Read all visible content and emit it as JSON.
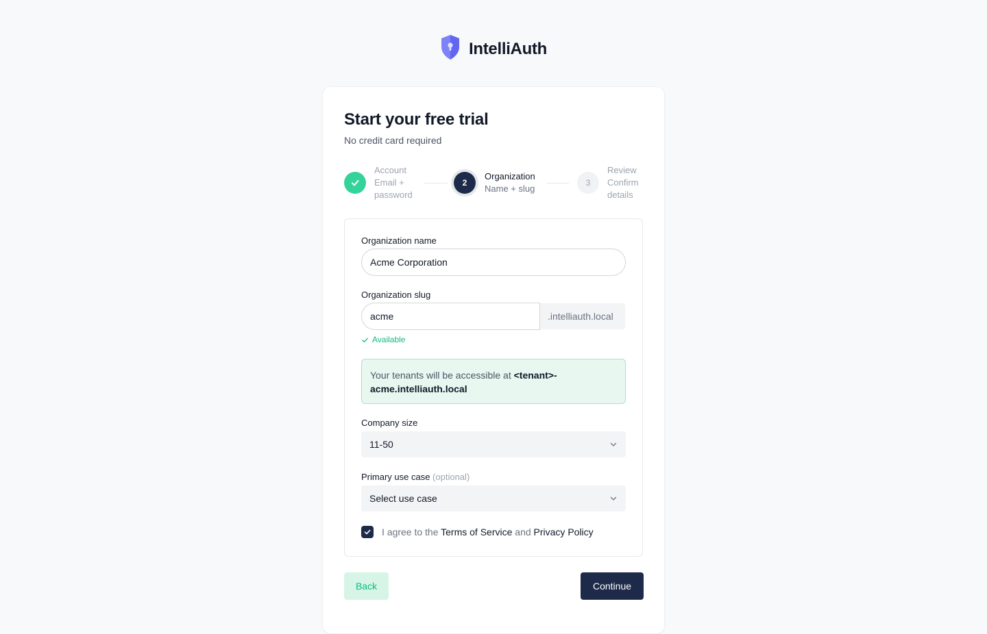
{
  "brand": {
    "name": "IntelliAuth",
    "logo_icon": "shield-lock-icon",
    "accent": "#6366f1"
  },
  "card": {
    "title": "Start your free trial",
    "subtitle": "No credit card required"
  },
  "steps": [
    {
      "number": "1",
      "title": "Account",
      "subtitle": "Email + password",
      "status": "complete"
    },
    {
      "number": "2",
      "title": "Organization",
      "subtitle": "Name + slug",
      "status": "current"
    },
    {
      "number": "3",
      "title": "Review",
      "subtitle": "Confirm details",
      "status": "upcoming"
    }
  ],
  "form": {
    "org_name": {
      "label": "Organization name",
      "value": "Acme Corporation"
    },
    "org_slug": {
      "label": "Organization slug",
      "value": "acme",
      "suffix": ".intelliauth.local",
      "status": "Available"
    },
    "info": {
      "prefix": "Your tenants will be accessible at ",
      "url": "<tenant>-acme.intelliauth.local"
    },
    "company_size": {
      "label": "Company size",
      "value": "11-50"
    },
    "use_case": {
      "label": "Primary use case",
      "optional": "(optional)",
      "value": "Select use case"
    },
    "agree": {
      "checked": true,
      "text_before": "I agree to the ",
      "terms": "Terms of Service",
      "and": " and ",
      "privacy": "Privacy Policy"
    }
  },
  "actions": {
    "back": "Back",
    "continue": "Continue"
  },
  "colors": {
    "primary": "#1e2a4a",
    "success": "#10b981",
    "success_bg": "#e8f7f0"
  }
}
